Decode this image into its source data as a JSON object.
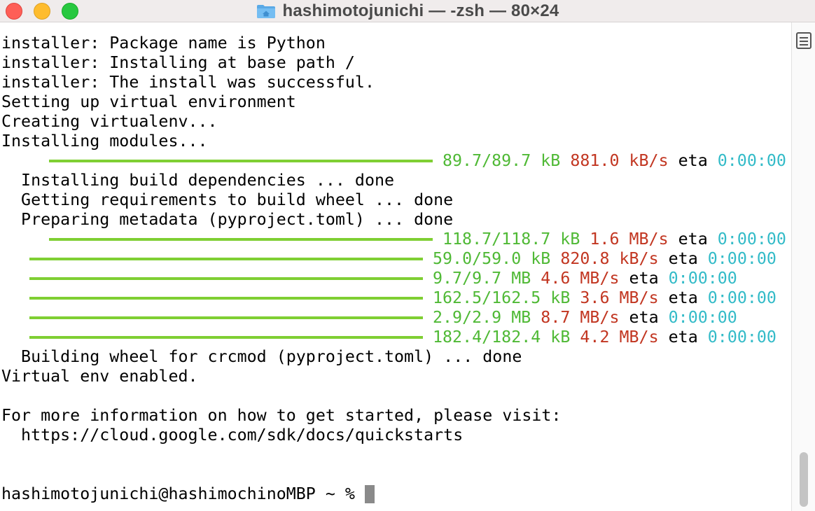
{
  "window": {
    "title": "hashimotojunichi — -zsh — 80×24",
    "title_icon": "home-folder-icon",
    "traffic_lights": {
      "close": "#fe5f57",
      "minimize": "#febc2e",
      "zoom": "#28c840"
    }
  },
  "colors": {
    "green": "#4fb935",
    "red": "#c23621",
    "cyan": "#33bbc8",
    "bar": "#7fcf33"
  },
  "terminal": {
    "lines": {
      "l1": "installer: Package name is Python",
      "l2": "installer: Installing at base path /",
      "l3": "installer: The install was successful.",
      "l4": "Setting up virtual environment",
      "l5": "Creating virtualenv...",
      "l6": "Installing modules...",
      "l8": "  Installing build dependencies ... done",
      "l9": "  Getting requirements to build wheel ... done",
      "l10": "  Preparing metadata (pyproject.toml) ... done",
      "l17": "  Building wheel for crcmod (pyproject.toml) ... done",
      "l18": "Virtual env enabled.",
      "l20": "For more information on how to get started, please visit:",
      "l21": "  https://cloud.google.com/sdk/docs/quickstarts",
      "prompt": "hashimotojunichi@hashimochinoMBP ~ % "
    },
    "progress": [
      {
        "size": "89.7/89.7 kB",
        "speed": "881.0 kB/s",
        "eta_label": "eta",
        "eta": "0:00:00",
        "progress": 1.0
      },
      {
        "size": "118.7/118.7 kB",
        "speed": "1.6 MB/s",
        "eta_label": "eta",
        "eta": "0:00:00",
        "progress": 1.0
      },
      {
        "size": "59.0/59.0 kB",
        "speed": "820.8 kB/s",
        "eta_label": "eta",
        "eta": "0:00:00",
        "progress": 1.0
      },
      {
        "size": "9.7/9.7 MB",
        "speed": "4.6 MB/s",
        "eta_label": "eta",
        "eta": "0:00:00",
        "progress": 1.0
      },
      {
        "size": "162.5/162.5 kB",
        "speed": "3.6 MB/s",
        "eta_label": "eta",
        "eta": "0:00:00",
        "progress": 1.0
      },
      {
        "size": "2.9/2.9 MB",
        "speed": "8.7 MB/s",
        "eta_label": "eta",
        "eta": "0:00:00",
        "progress": 1.0
      },
      {
        "size": "182.4/182.4 kB",
        "speed": "4.2 MB/s",
        "eta_label": "eta",
        "eta": "0:00:00",
        "progress": 1.0
      }
    ]
  },
  "scrollbar": {
    "toggle_icon": "split-pane-icon"
  }
}
